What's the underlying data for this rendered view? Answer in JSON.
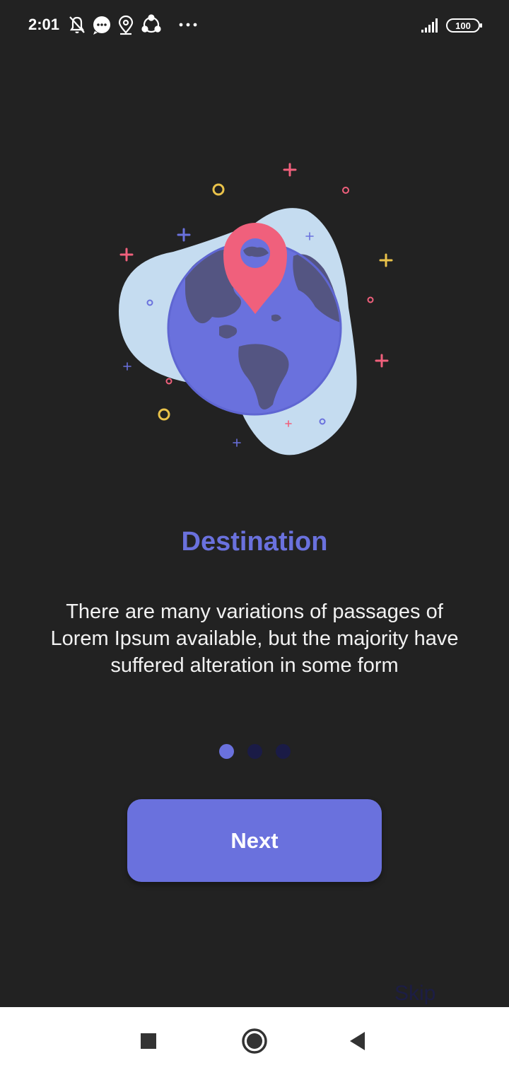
{
  "status_bar": {
    "time": "2:01",
    "left_icons": [
      "notifications-off-icon",
      "message-icon",
      "location-icon",
      "share-icon",
      "more-dots-icon"
    ],
    "battery": "100",
    "signal_icon": "signal-icon"
  },
  "onboarding": {
    "illustration_icon": "globe-location-pin-icon",
    "title": "Destination",
    "description": "There are many variations of passages of Lorem Ipsum available, but the majority have suffered alteration in some form",
    "page_count": 3,
    "active_page": 1,
    "next_label": "Next",
    "skip_label": "Skip"
  },
  "nav_bar": {
    "buttons": [
      "recents-square-icon",
      "home-circle-icon",
      "back-triangle-icon"
    ]
  },
  "colors": {
    "background": "#222222",
    "accent": "#6a71dd",
    "inactive_dot": "#1a1b46",
    "pin": "#f0607c",
    "blob": "#c5dcf0"
  }
}
